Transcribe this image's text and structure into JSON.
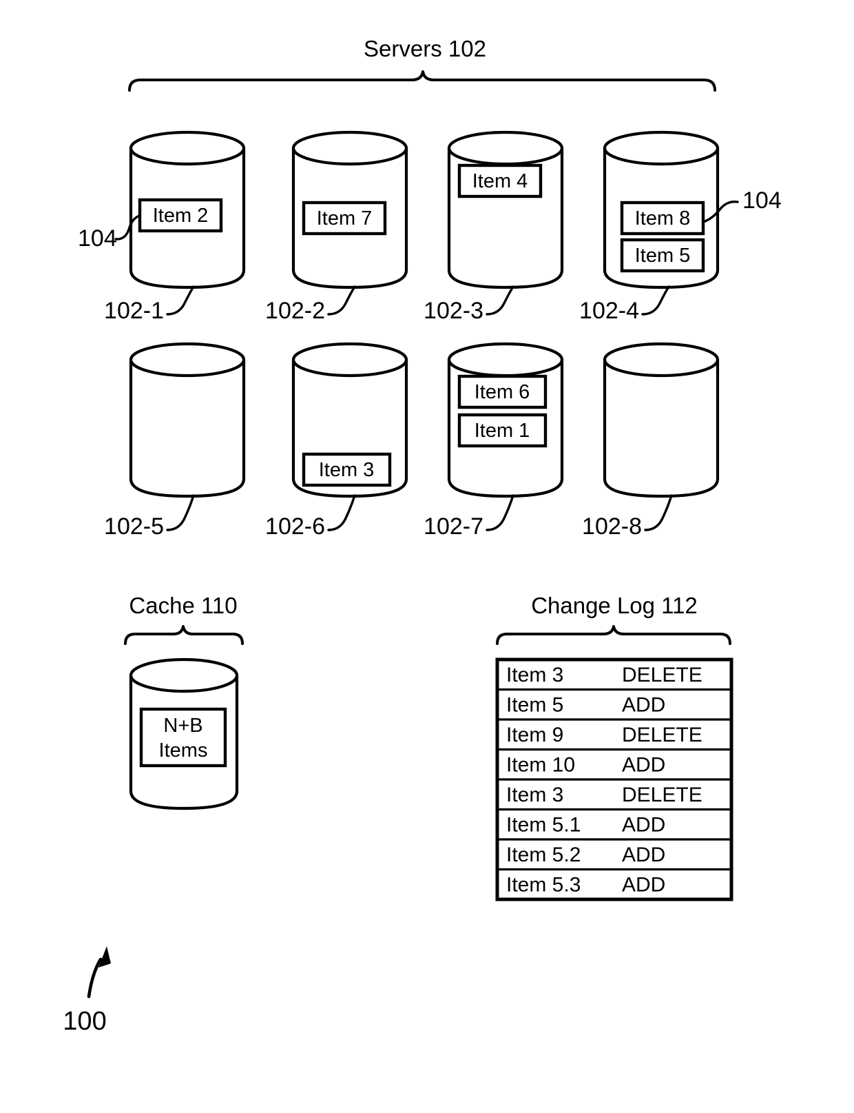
{
  "figure": {
    "number": "100",
    "servers_title": "Servers 102",
    "cache_title": "Cache 110",
    "changelog_title": "Change Log 112",
    "callout_left": "104",
    "callout_right": "104"
  },
  "servers": [
    {
      "ref": "102-1",
      "items": [
        "Item 2"
      ]
    },
    {
      "ref": "102-2",
      "items": [
        "Item 7"
      ]
    },
    {
      "ref": "102-3",
      "items": [
        "Item 4"
      ]
    },
    {
      "ref": "102-4",
      "items": [
        "Item 8",
        "Item 5"
      ]
    },
    {
      "ref": "102-5",
      "items": []
    },
    {
      "ref": "102-6",
      "items": [
        "Item 3"
      ]
    },
    {
      "ref": "102-7",
      "items": [
        "Item 6",
        "Item 1"
      ]
    },
    {
      "ref": "102-8",
      "items": []
    }
  ],
  "cache": {
    "label_line1": "N+B",
    "label_line2": "Items"
  },
  "change_log": {
    "rows": [
      {
        "item": "Item 3",
        "action": "DELETE"
      },
      {
        "item": "Item 5",
        "action": "ADD"
      },
      {
        "item": "Item 9",
        "action": "DELETE"
      },
      {
        "item": "Item 10",
        "action": "ADD"
      },
      {
        "item": "Item 3",
        "action": "DELETE"
      },
      {
        "item": "Item 5.1",
        "action": "ADD"
      },
      {
        "item": "Item 5.2",
        "action": "ADD"
      },
      {
        "item": "Item 5.3",
        "action": "ADD"
      }
    ]
  },
  "colors": {
    "ink": "#000000",
    "paper": "#ffffff"
  }
}
